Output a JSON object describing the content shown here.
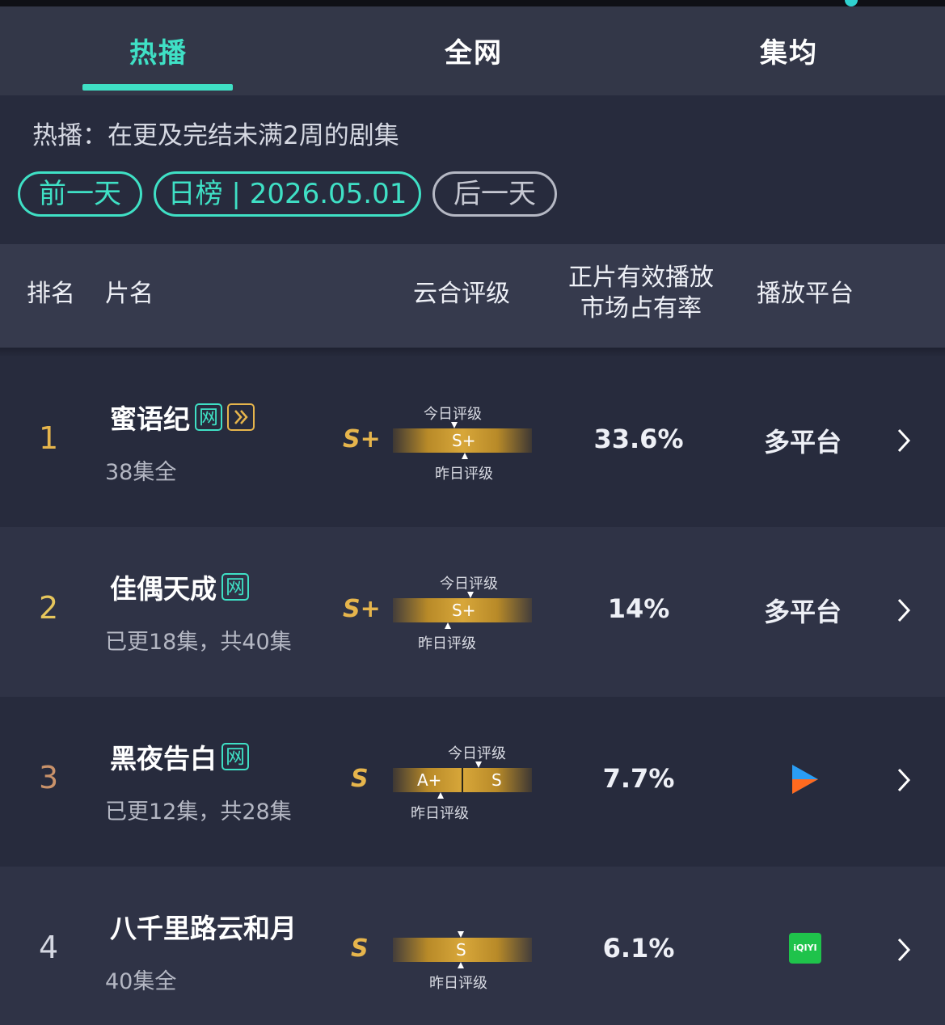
{
  "tabs": [
    {
      "label": "热播",
      "active": true
    },
    {
      "label": "全网",
      "active": false
    },
    {
      "label": "集均",
      "active": false
    }
  ],
  "description": "热播：在更及完结未满2周的剧集",
  "nav": {
    "prev": "前一天",
    "current": "日榜 | 2026.05.01",
    "next": "后一天"
  },
  "columns": {
    "rank": "排名",
    "title": "片名",
    "grade": "云合评级",
    "share_line1": "正片有效播放",
    "share_line2": "市场占有率",
    "platform": "播放平台"
  },
  "rows": [
    {
      "rank": "1",
      "rank_color": "#e6b54c",
      "title": "蜜语纪",
      "badge_net": "网",
      "subtitle": "38集全",
      "grade": "S+",
      "bar_label": "S+",
      "today_label": "今日评级",
      "yesterday_label": "昨日评级",
      "share": "33.6%",
      "platform": "多平台"
    },
    {
      "rank": "2",
      "rank_color": "#e6c65c",
      "title": "佳偶天成",
      "badge_net": "网",
      "subtitle": "已更18集，共40集",
      "grade": "S+",
      "bar_label": "S+",
      "today_label": "今日评级",
      "yesterday_label": "昨日评级",
      "share": "14%",
      "platform": "多平台"
    },
    {
      "rank": "3",
      "rank_color": "#c9926a",
      "title": "黑夜告白",
      "badge_net": "网",
      "subtitle": "已更12集，共28集",
      "grade": "S",
      "bar_left": "A+",
      "bar_right": "S",
      "today_label": "今日评级",
      "yesterday_label": "昨日评级",
      "share": "7.7%",
      "platform_icon": "youku-play-icon"
    },
    {
      "rank": "4",
      "rank_color": "#d5d8e2",
      "title": "八千里路云和月",
      "subtitle": "40集全",
      "grade": "S",
      "bar_label": "S",
      "yesterday_label": "昨日评级",
      "share": "6.1%",
      "platform_icon": "iqiyi-logo-icon",
      "platform_logo_text": "iQIYI"
    }
  ],
  "colors": {
    "accent": "#3fe0c5",
    "gold": "#e6b54c",
    "bg": "#272b3d"
  }
}
